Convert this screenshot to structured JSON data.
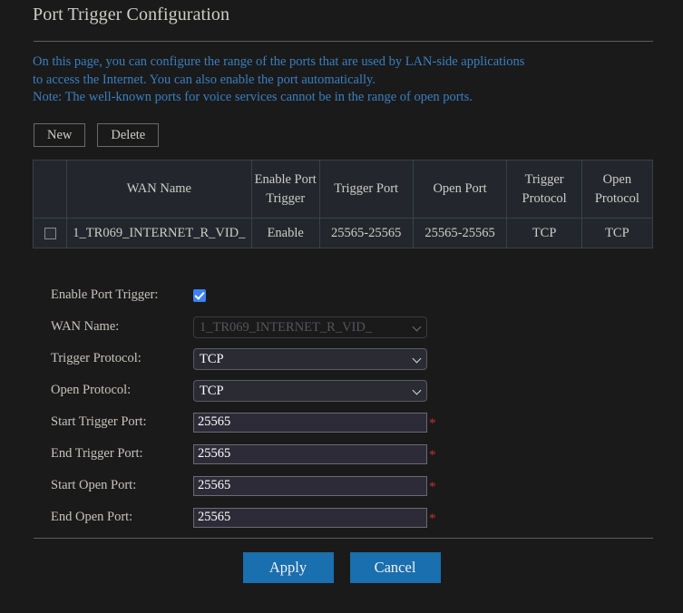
{
  "page": {
    "title": "Port Trigger Configuration",
    "description_lines": [
      "On this page, you can configure the range of the ports that are used by LAN-side applications",
      "to access the Internet. You can also enable the port automatically.",
      "Note: The well-known ports for voice services cannot be in the range of open ports."
    ]
  },
  "toolbar": {
    "new_label": "New",
    "delete_label": "Delete"
  },
  "table": {
    "headers": {
      "select": "",
      "wan_name": "WAN Name",
      "enable_port_trigger": "Enable Port Trigger",
      "trigger_port": "Trigger Port",
      "open_port": "Open Port",
      "trigger_protocol": "Trigger Protocol",
      "open_protocol": "Open Protocol"
    },
    "rows": [
      {
        "wan_name": "1_TR069_INTERNET_R_VID_",
        "enable_port_trigger": "Enable",
        "trigger_port": "25565-25565",
        "open_port": "25565-25565",
        "trigger_protocol": "TCP",
        "open_protocol": "TCP"
      }
    ]
  },
  "form": {
    "enable_port_trigger": {
      "label": "Enable Port Trigger:",
      "checked": "true"
    },
    "wan_name": {
      "label": "WAN Name:",
      "value": "1_TR069_INTERNET_R_VID_",
      "disabled": "true"
    },
    "trigger_protocol": {
      "label": "Trigger Protocol:",
      "value": "TCP"
    },
    "open_protocol": {
      "label": "Open Protocol:",
      "value": "TCP"
    },
    "start_trigger_port": {
      "label": "Start Trigger Port:",
      "value": "25565",
      "required_marker": "*"
    },
    "end_trigger_port": {
      "label": "End Trigger Port:",
      "value": "25565",
      "required_marker": "*"
    },
    "start_open_port": {
      "label": "Start Open Port:",
      "value": "25565",
      "required_marker": "*"
    },
    "end_open_port": {
      "label": "End Open Port:",
      "value": "25565",
      "required_marker": "*"
    }
  },
  "footer": {
    "apply_label": "Apply",
    "cancel_label": "Cancel"
  },
  "colors": {
    "background": "#1a1a1a",
    "description_text": "#3a7fc1",
    "label_text": "#c8c4bc",
    "primary_button": "#1a6fae",
    "checkbox_checked": "#3b82f6",
    "required_asterisk": "#c6302f",
    "table_cell_background": "#23272d"
  }
}
